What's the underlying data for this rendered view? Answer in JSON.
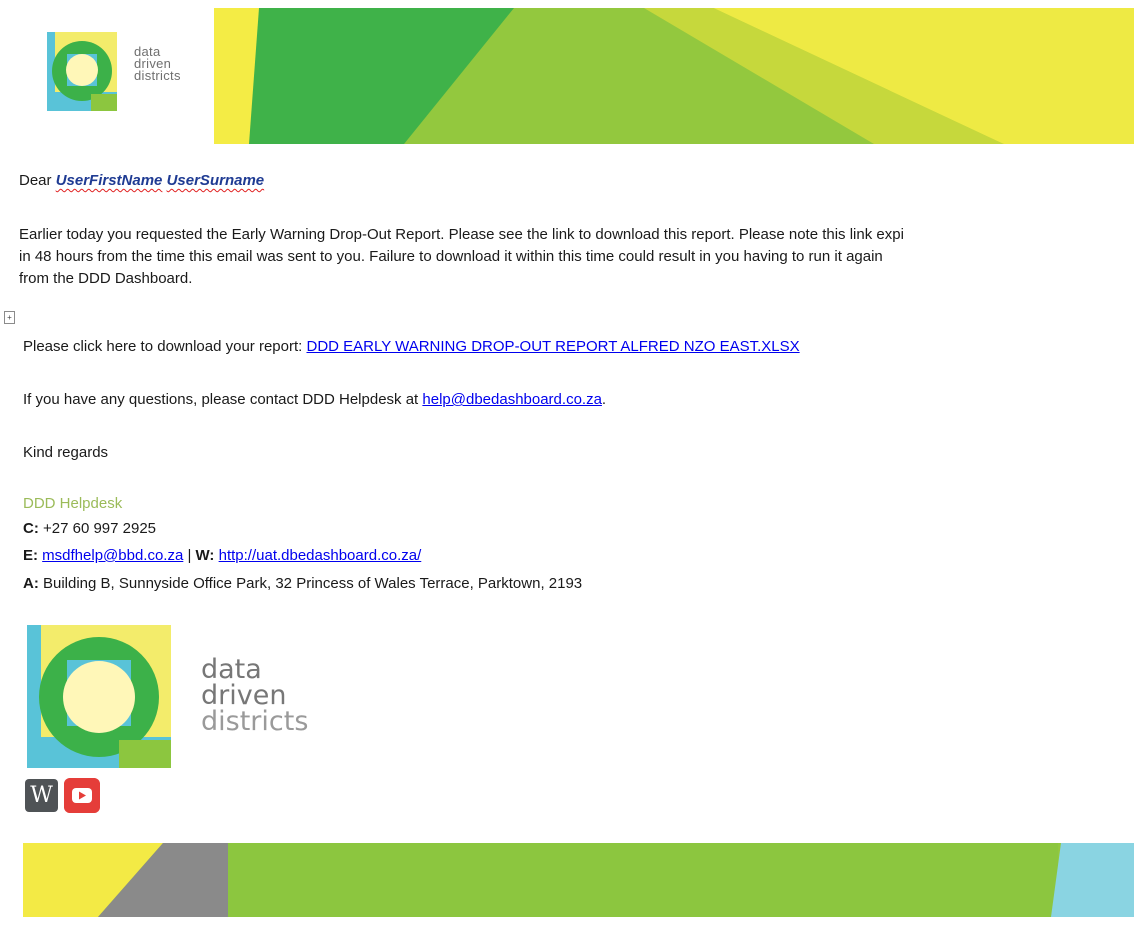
{
  "logo": {
    "line1": "data",
    "line2": "driven",
    "line3": "districts"
  },
  "greeting": {
    "prefix": "Dear ",
    "first_name": "UserFirstName",
    "surname": "UserSurname"
  },
  "intro": {
    "line1": "Earlier today you requested the Early Warning Drop-Out Report. Please see the link to download this report. Please note this link expi",
    "line2": "in 48 hours from the time this email was sent to you. Failure to download it within this time could result in you having to run it again",
    "line3": "from the DDD Dashboard."
  },
  "download": {
    "prefix": "Please click here to download your report: ",
    "link_text": "DDD EARLY WARNING DROP-OUT REPORT  ALFRED NZO EAST.XLSX"
  },
  "questions": {
    "prefix": "If you have any questions, please contact DDD Helpdesk at ",
    "email": "help@dbedashboard.co.za",
    "suffix": "."
  },
  "closing": "Kind regards",
  "signature": {
    "name": "DDD Helpdesk",
    "c_label": "C:",
    "phone": " +27 60 997 2925",
    "e_label": "E:",
    "email": "msdfhelp@bbd.co.za",
    "separator": " | ",
    "w_label": "W:",
    "website": "http://uat.dbedashboard.co.za/",
    "a_label": "A:",
    "address": " Building B, Sunnyside Office Park, 32 Princess of Wales Terrace, Parktown, 2193"
  },
  "social": {
    "wikipedia_glyph": "W",
    "youtube": "youtube-icon"
  },
  "colors": {
    "brand_green": "#3cb149",
    "lime": "#8cc63f",
    "yellow": "#f4ec45",
    "link": "#0000ee",
    "name_blue": "#1f3b93",
    "signature_green": "#9bbb59"
  }
}
